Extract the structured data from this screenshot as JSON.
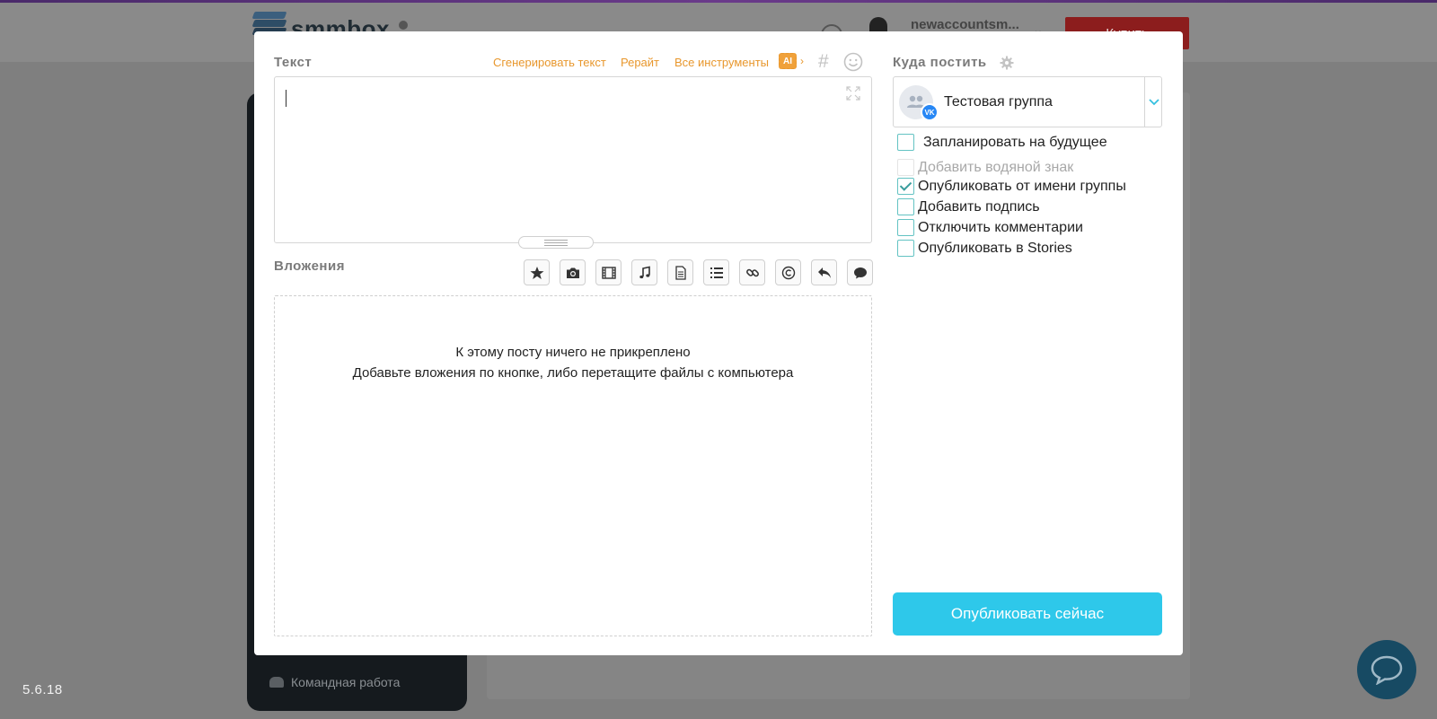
{
  "app": {
    "logo_text": "smmbox",
    "account_name": "newaccountsm...",
    "buy_label": "Купить",
    "sidebar_team_label": "Командная работа",
    "version": "5.6.18"
  },
  "modal": {
    "text_section": {
      "label": "Текст",
      "tools": [
        "Сгенерировать текст",
        "Рерайт",
        "Все инструменты"
      ],
      "ai_badge": "AI",
      "hash_symbol": "#"
    },
    "attachments": {
      "label": "Вложения",
      "buttons": [
        "star-icon",
        "camera-icon",
        "film-icon",
        "music-icon",
        "document-icon",
        "list-icon",
        "link-icon",
        "copyright-icon",
        "reply-icon",
        "comment-icon"
      ],
      "empty_line1": "К этому посту ничего не прикреплено",
      "empty_line2": "Добавьте вложения по кнопке, либо перетащите файлы с компьютера"
    },
    "target": {
      "label": "Куда постить",
      "group_name": "Тестовая группа",
      "network_badge": "VK"
    },
    "options": [
      {
        "label": "Запланировать на будущее",
        "checked": false,
        "disabled": false
      },
      {
        "label": "Добавить водяной знак",
        "checked": false,
        "disabled": true
      },
      {
        "label": "Опубликовать от имени группы",
        "checked": true,
        "disabled": false
      },
      {
        "label": "Добавить подпись",
        "checked": false,
        "disabled": false
      },
      {
        "label": "Отключить комментарии",
        "checked": false,
        "disabled": false
      },
      {
        "label": "Опубликовать в Stories",
        "checked": false,
        "disabled": false
      }
    ],
    "publish_label": "Опубликовать сейчас"
  },
  "colors": {
    "accent_orange": "#e8972d",
    "publish_blue": "#2ec8ea",
    "checkbox_teal": "#63c3c3",
    "vk_blue": "#2787f5"
  }
}
